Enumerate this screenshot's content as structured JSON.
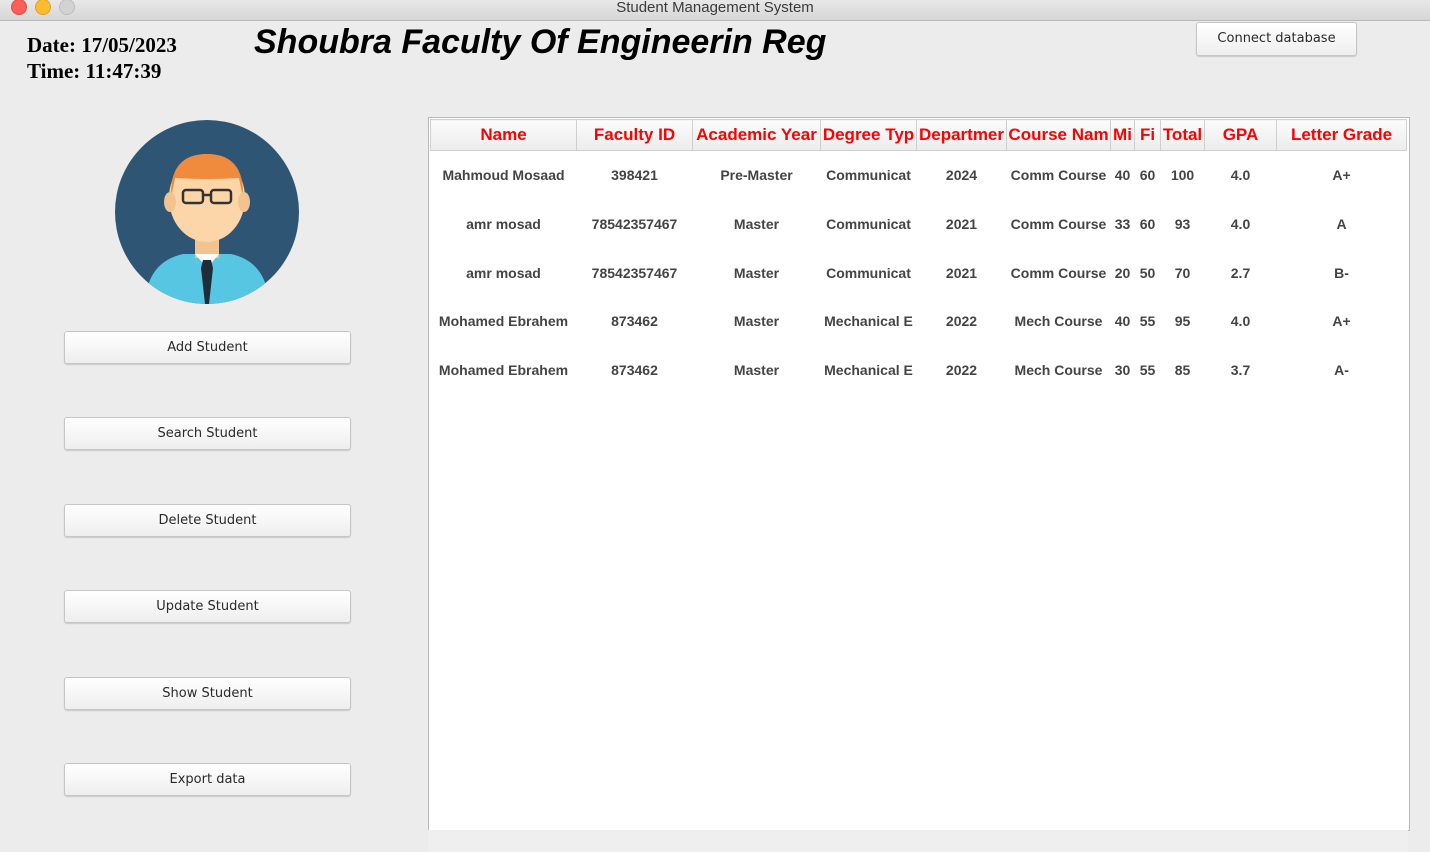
{
  "window": {
    "title": "Student Management System"
  },
  "header": {
    "date": "Date: 17/05/2023",
    "time": "Time: 11:47:39",
    "title": "Shoubra Faculty Of Engineerin Reg",
    "connect_button": "Connect database"
  },
  "sidebar": {
    "buttons": [
      {
        "label": "Add Student"
      },
      {
        "label": "Search Student"
      },
      {
        "label": "Delete Student"
      },
      {
        "label": "Update Student"
      },
      {
        "label": "Show Student"
      },
      {
        "label": "Export data"
      }
    ]
  },
  "colors": {
    "header_text": "#ff0000",
    "avatar_bg": "#2f5574"
  },
  "table": {
    "columns": [
      "Name",
      "Faculty ID",
      "Academic Year",
      "Degree Typ",
      "Departmer",
      "Course Nam",
      "Mi",
      "Fi",
      "Total",
      "GPA",
      "Letter Grade"
    ],
    "rows": [
      [
        "Mahmoud Mosaad",
        "398421",
        "Pre-Master",
        "Communicat",
        "2024",
        "Comm Course",
        "40",
        "60",
        "100",
        "4.0",
        "A+"
      ],
      [
        "amr mosad",
        "78542357467",
        "Master",
        "Communicat",
        "2021",
        "Comm Course",
        "33",
        "60",
        "93",
        "4.0",
        "A"
      ],
      [
        "amr mosad",
        "78542357467",
        "Master",
        "Communicat",
        "2021",
        "Comm Course",
        "20",
        "50",
        "70",
        "2.7",
        "B-"
      ],
      [
        "Mohamed Ebrahem",
        "873462",
        "Master",
        "Mechanical E",
        "2022",
        "Mech Course",
        "40",
        "55",
        "95",
        "4.0",
        "A+"
      ],
      [
        "Mohamed Ebrahem",
        "873462",
        "Master",
        "Mechanical E",
        "2022",
        "Mech Course",
        "30",
        "55",
        "85",
        "3.7",
        "A-"
      ]
    ]
  }
}
